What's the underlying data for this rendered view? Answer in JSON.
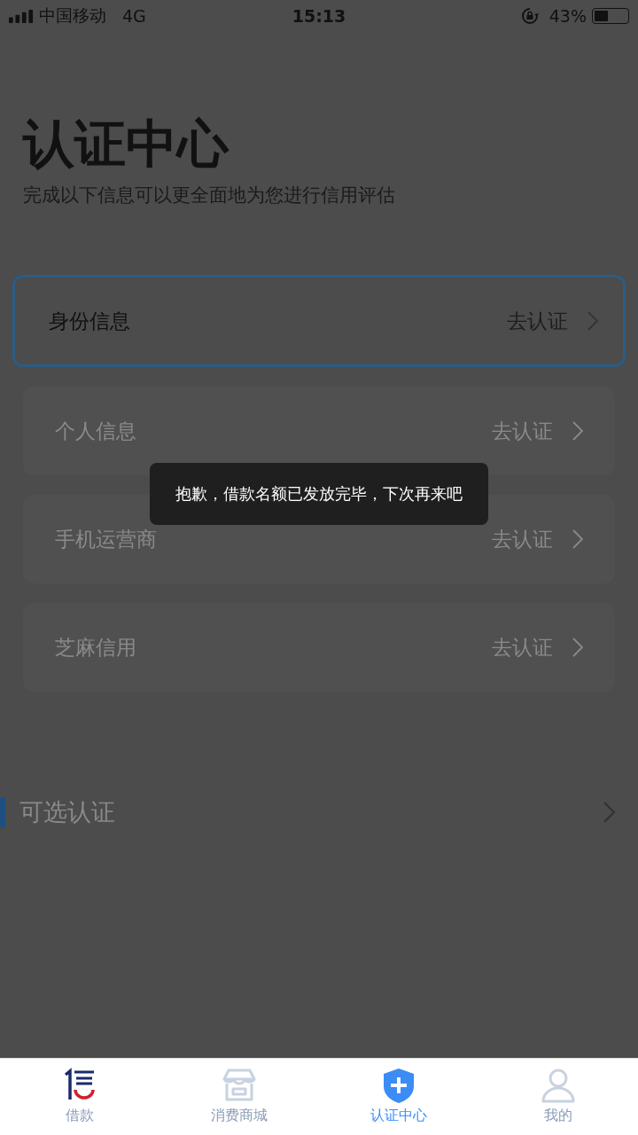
{
  "status_bar": {
    "carrier": "中国移动",
    "network": "4G",
    "time": "15:13",
    "battery_text": "43%",
    "battery": {
      "level": 0.43
    }
  },
  "header": {
    "title": "认证中心",
    "subtitle": "完成以下信息可以更全面地为您进行信用评估"
  },
  "items": [
    {
      "label": "身份信息",
      "action": "去认证",
      "selected": true
    },
    {
      "label": "个人信息",
      "action": "去认证",
      "selected": false
    },
    {
      "label": "手机运营商",
      "action": "去认证",
      "selected": false
    },
    {
      "label": "芝麻信用",
      "action": "去认证",
      "selected": false
    }
  ],
  "optional": {
    "label": "可选认证"
  },
  "toast": "抱歉，借款名额已发放完毕，下次再来吧",
  "tabs": [
    {
      "label": "借款",
      "kind": "loan",
      "selected": false
    },
    {
      "label": "消费商城",
      "kind": "shop",
      "selected": false
    },
    {
      "label": "认证中心",
      "kind": "shield",
      "selected": true
    },
    {
      "label": "我的",
      "kind": "user",
      "selected": false
    }
  ]
}
